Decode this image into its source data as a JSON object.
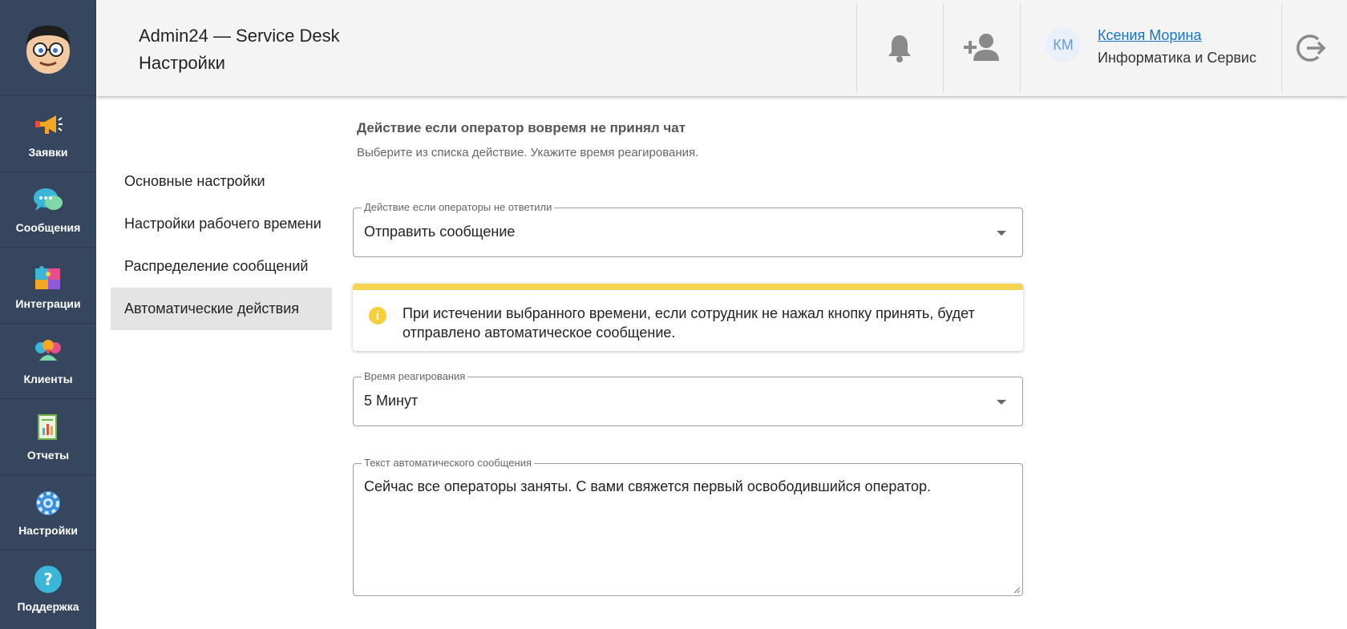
{
  "rail": {
    "items": [
      {
        "label": "Заявки",
        "icon": "megaphone-icon"
      },
      {
        "label": "Сообщения",
        "icon": "chat-bubble-icon"
      },
      {
        "label": "Интеграции",
        "icon": "puzzle-icon"
      },
      {
        "label": "Клиенты",
        "icon": "clients-icon"
      },
      {
        "label": "Отчеты",
        "icon": "report-icon"
      },
      {
        "label": "Настройки",
        "icon": "gear-icon"
      },
      {
        "label": "Поддержка",
        "icon": "help-icon"
      }
    ]
  },
  "header": {
    "app_title": "Admin24 — Service Desk",
    "page_title": "Настройки",
    "user": {
      "initials": "КМ",
      "name": "Ксения Морина",
      "org": "Информатика и Сервис"
    }
  },
  "subnav": {
    "items": [
      "Основные настройки",
      "Настройки рабочего времени",
      "Распределение сообщений",
      "Автоматические действия"
    ],
    "active_index": 3
  },
  "section": {
    "title": "Действие если оператор вовремя не принял чат",
    "subtitle": "Выберите из списка действие. Укажите время реагирования."
  },
  "action_field": {
    "label": "Действие если операторы не ответили",
    "value": "Отправить сообщение"
  },
  "notice": {
    "icon": "info-icon",
    "text": "При истечении выбранного времени, если сотрудник не нажал кнопку принять, будет отправлено автоматическое сообщение."
  },
  "time_field": {
    "label": "Время реагирования",
    "value": "5 Минут"
  },
  "message_field": {
    "label": "Текст автоматического сообщения",
    "value": "Сейчас все операторы заняты. С вами свяжется первый освободившийся оператор."
  },
  "colors": {
    "rail_bg": "#36465f",
    "header_bg": "#f4f4f4",
    "notice_accent": "#f6d453",
    "link": "#1a73c9"
  }
}
